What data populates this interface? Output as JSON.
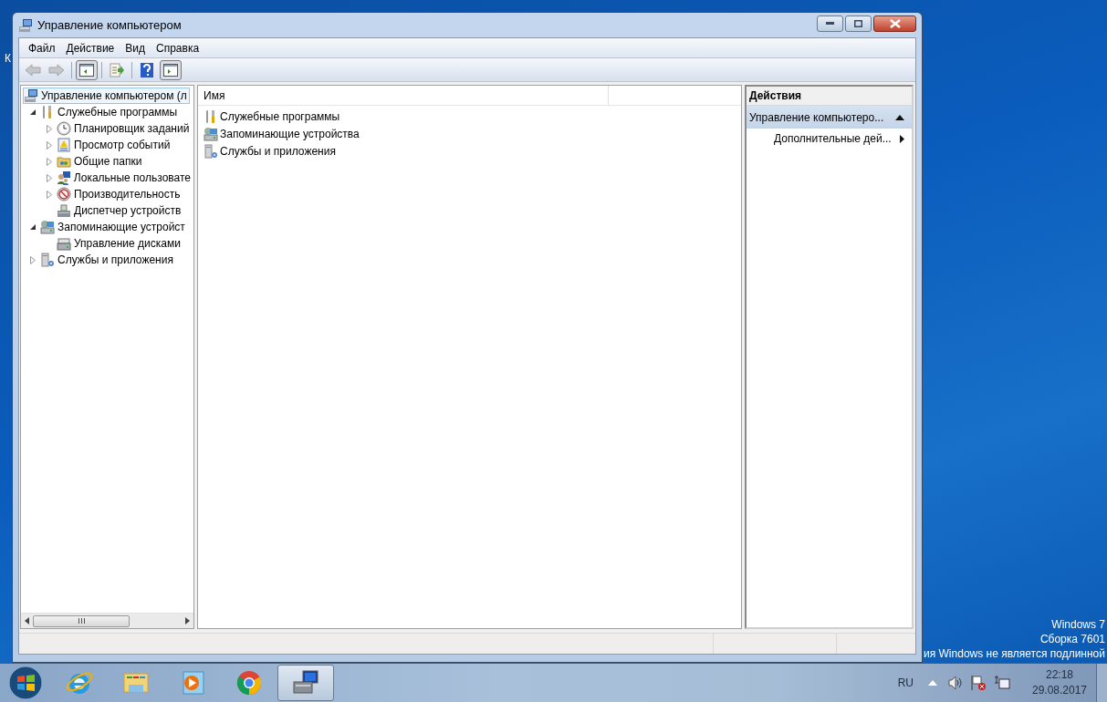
{
  "desktop": {
    "icon_label": "К",
    "watermark": [
      "Windows 7",
      "Сборка 7601",
      "ия Windows не является подлинной"
    ]
  },
  "window": {
    "title": "Управление компьютером"
  },
  "menu": [
    "Файл",
    "Действие",
    "Вид",
    "Справка"
  ],
  "toolbar": [
    {
      "kind": "back",
      "disabled": true,
      "pressed": false
    },
    {
      "kind": "forward",
      "disabled": true,
      "pressed": false
    },
    {
      "kind": "tree_toggle",
      "disabled": false,
      "pressed": true
    },
    {
      "kind": "export",
      "disabled": false,
      "pressed": false
    },
    {
      "kind": "help",
      "disabled": false,
      "pressed": false
    },
    {
      "kind": "action_toggle",
      "disabled": false,
      "pressed": true
    }
  ],
  "tree": [
    {
      "label": "Управление компьютером (л",
      "selected": true,
      "children": [
        {
          "label": "Служебные программы",
          "selected": false,
          "expandable": true,
          "expanded": true,
          "children": [
            {
              "label": "Планировщик заданий",
              "selected": false,
              "expandable": true,
              "expanded": false
            },
            {
              "label": "Просмотр событий",
              "selected": false,
              "expandable": true,
              "expanded": false
            },
            {
              "label": "Общие папки",
              "selected": false,
              "expandable": true,
              "expanded": false
            },
            {
              "label": "Локальные пользовате",
              "selected": false,
              "expandable": true,
              "expanded": false
            },
            {
              "label": "Производительность",
              "selected": false,
              "expandable": true,
              "expanded": false
            },
            {
              "label": "Диспетчер устройств",
              "selected": false
            }
          ]
        },
        {
          "label": "Запоминающие устройст",
          "selected": false,
          "expandable": true,
          "expanded": true,
          "children": [
            {
              "label": "Управление дисками",
              "selected": false
            }
          ]
        },
        {
          "label": "Службы и приложения",
          "selected": false,
          "expandable": true,
          "expanded": false
        }
      ]
    }
  ],
  "list": {
    "columns": [
      "Имя"
    ],
    "rows": [
      "Служебные программы",
      "Запоминающие устройства",
      "Службы и приложения"
    ]
  },
  "actions": {
    "title": "Действия",
    "section": "Управление компьютеро...",
    "expanded": true,
    "items": [
      "Дополнительные дей..."
    ]
  },
  "taskbar": {
    "apps": [
      {
        "kind": "browser",
        "active": false
      },
      {
        "kind": "folder",
        "active": false
      },
      {
        "kind": "media",
        "active": false
      },
      {
        "kind": "chrome",
        "active": false
      },
      {
        "kind": "computer",
        "active": true
      }
    ],
    "language": "RU",
    "time": "22:18",
    "date": "29.08.2017"
  }
}
